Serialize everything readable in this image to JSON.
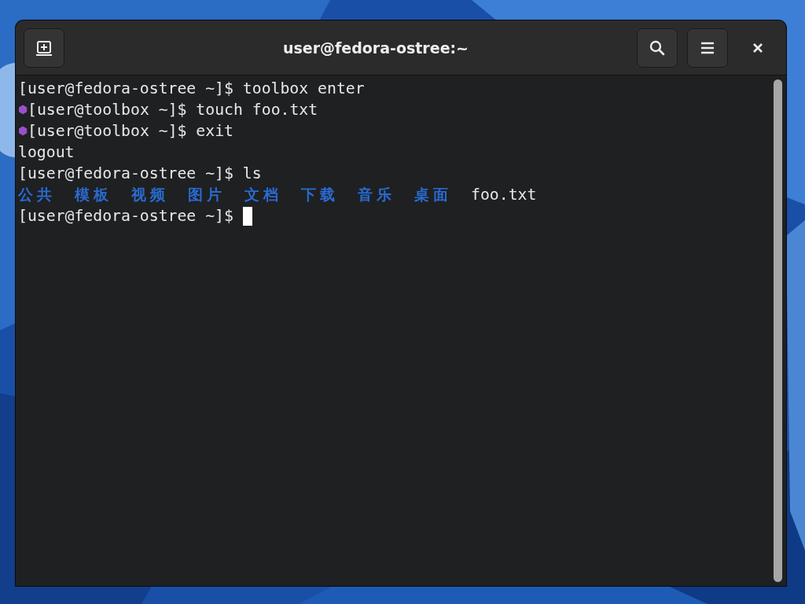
{
  "window": {
    "title": "user@fedora-ostree:~"
  },
  "terminal": {
    "lines": [
      {
        "segments": [
          {
            "kind": "plain",
            "text": "[user@fedora-ostree ~]$ toolbox enter"
          }
        ]
      },
      {
        "segments": [
          {
            "kind": "marker",
            "text": "⬢"
          },
          {
            "kind": "plain",
            "text": "[user@toolbox ~]$ touch foo.txt"
          }
        ]
      },
      {
        "segments": [
          {
            "kind": "marker",
            "text": "⬢"
          },
          {
            "kind": "plain",
            "text": "[user@toolbox ~]$ exit"
          }
        ]
      },
      {
        "segments": [
          {
            "kind": "plain",
            "text": "logout"
          }
        ]
      },
      {
        "segments": [
          {
            "kind": "plain",
            "text": "[user@fedora-ostree ~]$ ls"
          }
        ]
      },
      {
        "listing": [
          {
            "kind": "dir",
            "text": "公共"
          },
          {
            "kind": "dir",
            "text": "模板"
          },
          {
            "kind": "dir",
            "text": "视频"
          },
          {
            "kind": "dir",
            "text": "图片"
          },
          {
            "kind": "dir",
            "text": "文档"
          },
          {
            "kind": "dir",
            "text": "下载"
          },
          {
            "kind": "dir",
            "text": "音乐"
          },
          {
            "kind": "dir",
            "text": "桌面"
          },
          {
            "kind": "file",
            "text": "foo.txt"
          }
        ]
      },
      {
        "segments": [
          {
            "kind": "plain",
            "text": "[user@fedora-ostree ~]$ "
          }
        ],
        "cursor": true
      }
    ]
  }
}
